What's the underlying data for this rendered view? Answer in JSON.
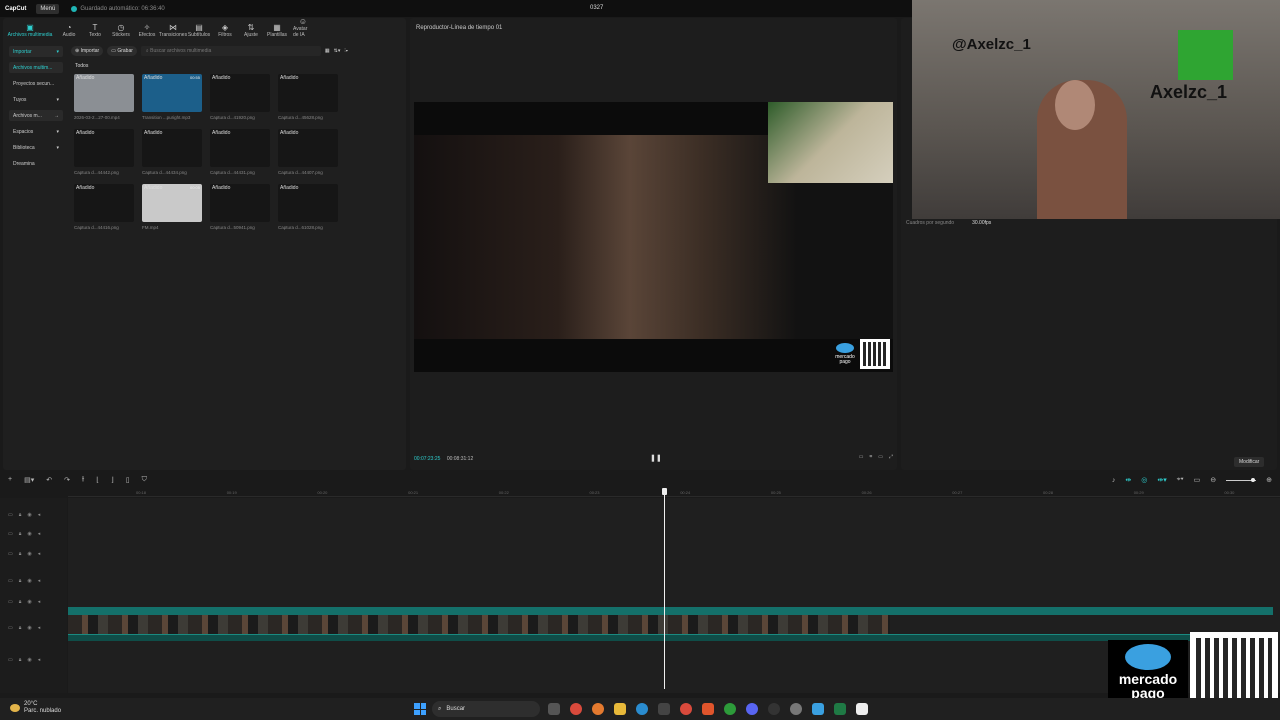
{
  "titlebar": {
    "app_name": "CapCut",
    "menu_label": "Menú",
    "autosave": "Guardado automático: 06:36:40",
    "project_title": "0327"
  },
  "toolbar": {
    "tools": [
      {
        "label": "Archivos multimedia",
        "icon": "media-icon",
        "glyph": "▣",
        "active": true
      },
      {
        "label": "Audio",
        "icon": "audio-icon",
        "glyph": "◔"
      },
      {
        "label": "Texto",
        "icon": "text-icon",
        "glyph": "T"
      },
      {
        "label": "Stickers",
        "icon": "sticker-icon",
        "glyph": "◷"
      },
      {
        "label": "Efectos",
        "icon": "effects-icon",
        "glyph": "✧"
      },
      {
        "label": "Transiciones",
        "icon": "transitions-icon",
        "glyph": "⋈"
      },
      {
        "label": "Subtítulos",
        "icon": "subtitles-icon",
        "glyph": "▤"
      },
      {
        "label": "Filtros",
        "icon": "filters-icon",
        "glyph": "◈"
      },
      {
        "label": "Ajuste",
        "icon": "adjust-icon",
        "glyph": "⇅"
      },
      {
        "label": "Plantillas",
        "icon": "templates-icon",
        "glyph": "▦"
      },
      {
        "label": "Avatar de IA",
        "icon": "ai-avatar-icon",
        "glyph": "☺"
      }
    ]
  },
  "side_nav": {
    "items": [
      {
        "label": "Importar",
        "arrow": "▾"
      },
      {
        "label": "Archivos multim...",
        "arrow": ""
      },
      {
        "label": "Proyectos secun...",
        "arrow": ""
      },
      {
        "label": "Tuyos",
        "arrow": "▾"
      },
      {
        "label": "Archivos m...",
        "arrow": "→"
      },
      {
        "label": "Espacios",
        "arrow": "▾"
      },
      {
        "label": "Biblioteca",
        "arrow": "▾"
      },
      {
        "label": "Dreamina",
        "arrow": ""
      }
    ]
  },
  "media": {
    "import_label": "Importar",
    "record_label": "Grabar",
    "search_placeholder": "Buscar archivos multimedia",
    "section_label": "Todos",
    "added_badge": "Añadido",
    "items": [
      {
        "caption": "2026-03-2...27-00.mp4",
        "duration": "",
        "bg": "#8b8f94"
      },
      {
        "caption": "Transition ...puright.mp3",
        "duration": "00:55",
        "bg": "#1c5f8a"
      },
      {
        "caption": "Captura d...41920.png",
        "duration": "",
        "bg": "#161616"
      },
      {
        "caption": "Captura d...45628.png",
        "duration": "",
        "bg": "#161616"
      },
      {
        "caption": "Captura d...44442.png",
        "duration": "",
        "bg": "#161616"
      },
      {
        "caption": "Captura d...44434.png",
        "duration": "",
        "bg": "#161616"
      },
      {
        "caption": "Captura d...44431.png",
        "duration": "",
        "bg": "#161616"
      },
      {
        "caption": "Captura d...44407.png",
        "duration": "",
        "bg": "#161616"
      },
      {
        "caption": "Captura d...44416.png",
        "duration": "",
        "bg": "#161616"
      },
      {
        "caption": "FM.mp4",
        "duration": "00:05",
        "bg": "#c9c9c9"
      },
      {
        "caption": "Captura d...50941.png",
        "duration": "",
        "bg": "#161616"
      },
      {
        "caption": "Captura d...61028.png",
        "duration": "",
        "bg": "#161616"
      }
    ]
  },
  "player": {
    "title": "Reproductor-Línea de tiempo 01",
    "current_time": "00:07:23:25",
    "total_time": "00:08:31:12",
    "mp_logo_text": "mercado pago"
  },
  "details": {
    "fps_label": "Cuadros por segundo",
    "fps_value": "30.00fps",
    "modify_label": "Modificar"
  },
  "webcam": {
    "handle": "@Axelzc_1",
    "name": "Axelzc_1"
  },
  "timeline": {
    "ticks": [
      "00:18",
      "00:19",
      "00:20",
      "00:21",
      "00:22",
      "00:23",
      "00:24",
      "00:25",
      "00:26",
      "00:27",
      "00:28",
      "00:29",
      "00:30"
    ]
  },
  "overlay": {
    "mp_text": "mercado pago"
  },
  "taskbar": {
    "temp": "20°C",
    "condition": "Parc. nublado",
    "search_label": "Buscar"
  },
  "colors": {
    "accent": "#2ecfcf",
    "clip": "#14706a"
  }
}
